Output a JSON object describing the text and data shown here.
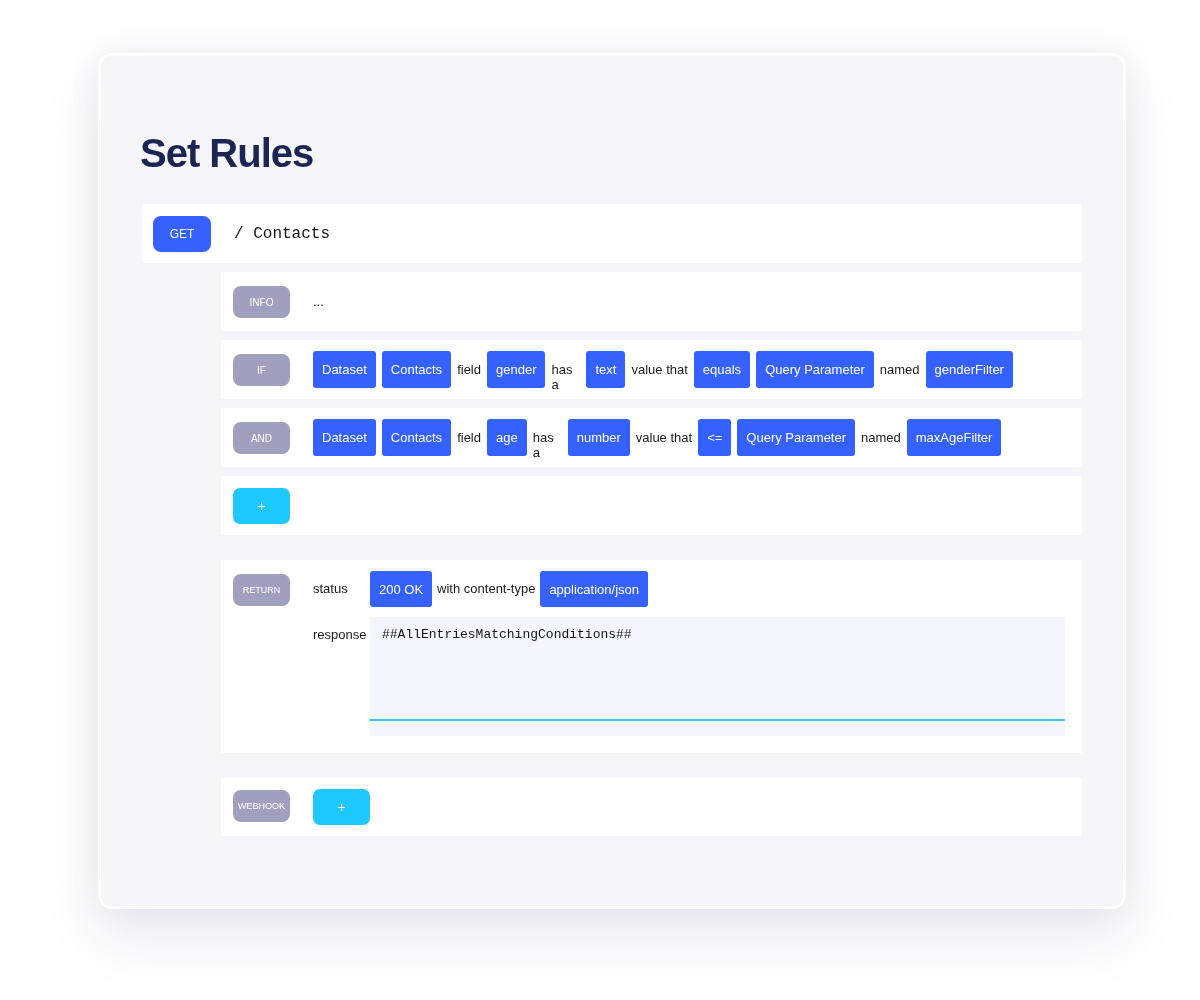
{
  "title": "Set Rules",
  "endpoint": {
    "method": "GET",
    "path": "/ Contacts"
  },
  "rules": [
    {
      "kind": "clause",
      "tag": "INFO",
      "tokens": [
        {
          "kind": "word",
          "text": "..."
        }
      ]
    },
    {
      "kind": "clause",
      "tag": "IF",
      "tokens": [
        {
          "kind": "chip",
          "text": "Dataset"
        },
        {
          "kind": "chip",
          "text": "Contacts"
        },
        {
          "kind": "word",
          "text": "field"
        },
        {
          "kind": "chip",
          "text": "gender"
        },
        {
          "kind": "stacked_word",
          "text": "has a"
        },
        {
          "kind": "chip",
          "text": "text"
        },
        {
          "kind": "word",
          "text": "value that"
        },
        {
          "kind": "chip",
          "text": "equals"
        },
        {
          "kind": "chip",
          "text": "Query Parameter"
        },
        {
          "kind": "word",
          "text": "named"
        },
        {
          "kind": "chip",
          "text": "genderFilter"
        }
      ]
    },
    {
      "kind": "clause",
      "tag": "AND",
      "tokens": [
        {
          "kind": "chip",
          "text": "Dataset"
        },
        {
          "kind": "chip",
          "text": "Contacts"
        },
        {
          "kind": "word",
          "text": "field"
        },
        {
          "kind": "chip",
          "text": "age"
        },
        {
          "kind": "stacked_word",
          "text": "has a"
        },
        {
          "kind": "chip",
          "text": "number"
        },
        {
          "kind": "word",
          "text": "value that"
        },
        {
          "kind": "chip",
          "text": "<="
        },
        {
          "kind": "chip",
          "text": "Query Parameter"
        },
        {
          "kind": "word",
          "text": "named"
        },
        {
          "kind": "chip",
          "text": "maxAgeFilter"
        }
      ]
    },
    {
      "kind": "add",
      "label": "+"
    }
  ],
  "return": {
    "tag": "RETURN",
    "status_label": "status",
    "status": "200 OK",
    "content_type_label": "with content-type",
    "content_type": "application/json",
    "response_label": "response",
    "response": "##AllEntriesMatchingConditions##"
  },
  "webhook": {
    "tag": "WEBHOOK",
    "add_label": "+"
  }
}
